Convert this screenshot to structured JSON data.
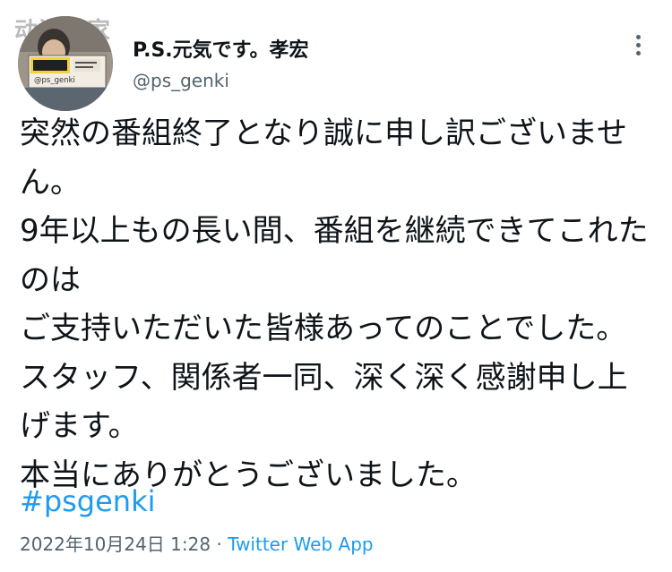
{
  "watermark": "动漫之家",
  "author": {
    "display_name": "P.S.元気です。孝宏",
    "handle": "@ps_genki",
    "avatar_sign_text": "@ps_genki"
  },
  "tweet": {
    "lines": [
      "突然の番組終了となり誠に申し訳ございませ",
      "ん。",
      "9年以上もの長い間、番組を継続できてこれた",
      "のは",
      "ご支持いただいた皆様あってのことでした。",
      "スタッフ、関係者一同、深く深く感謝申し上",
      "げます。",
      "本当にありがとうございました。"
    ],
    "hashtag": "#psgenki",
    "timestamp": "2022年10月24日 1:28",
    "separator": "·",
    "source": "Twitter Web App"
  },
  "icons": {
    "more": "more-options-icon"
  },
  "colors": {
    "text": "#0f1419",
    "secondary": "#536471",
    "link": "#1d9bf0"
  }
}
